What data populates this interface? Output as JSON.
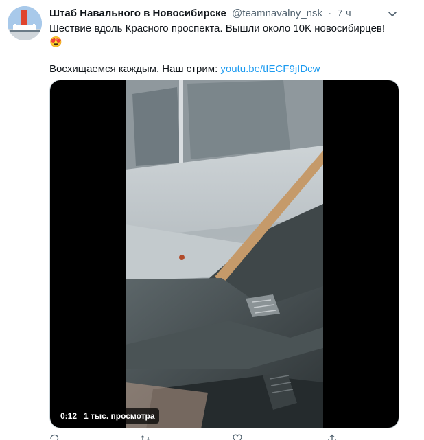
{
  "tweet": {
    "author_name": "Штаб Навального в Новосибирске",
    "handle": "@teamnavalny_nsk",
    "separator": "·",
    "time": "7 ч",
    "text_line1": "Шествие вдоль Красного проспекта. Вышли около 10K новосибирцев!",
    "emoji": "😍",
    "text_line2_prefix": "Восхищаемся каждым. Наш стрим: ",
    "link": "youtu.be/tIECF9jIDcw"
  },
  "video": {
    "duration": "0:12",
    "views": "1 тыс. просмотра"
  },
  "icons": {
    "more": "chevron-down-icon",
    "reply": "reply-icon",
    "retweet": "retweet-icon",
    "like": "like-icon",
    "share": "share-icon"
  },
  "colors": {
    "link": "#1d9bf0",
    "secondary_text": "#536471"
  }
}
